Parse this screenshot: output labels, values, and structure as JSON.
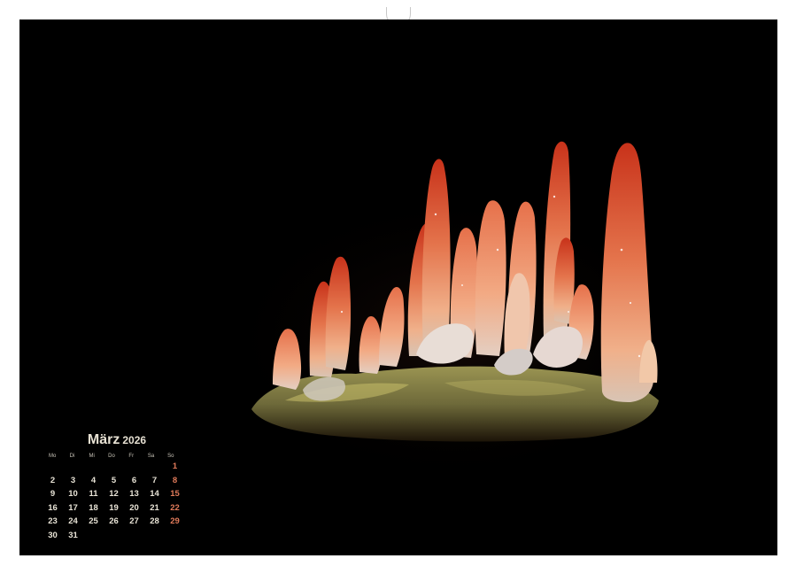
{
  "calendar": {
    "month": "März",
    "year": "2026",
    "weekdays": [
      "Mo",
      "Di",
      "Mi",
      "Do",
      "Fr",
      "Sa",
      "So"
    ],
    "first_weekday_index": 6,
    "days": [
      "1",
      "2",
      "3",
      "4",
      "5",
      "6",
      "7",
      "8",
      "9",
      "10",
      "11",
      "12",
      "13",
      "14",
      "15",
      "16",
      "17",
      "18",
      "19",
      "20",
      "21",
      "22",
      "23",
      "24",
      "25",
      "26",
      "27",
      "28",
      "29",
      "30",
      "31"
    ],
    "sunday_color": "#e07a5a",
    "text_color": "#e8e3d6"
  },
  "photo": {
    "subject": "mineral-crystal-cluster-icon",
    "background_color": "#000000",
    "crystal_colors": [
      "#c4381e",
      "#e0704a",
      "#f2b48c",
      "#d8d0c8",
      "#a8a030"
    ]
  }
}
